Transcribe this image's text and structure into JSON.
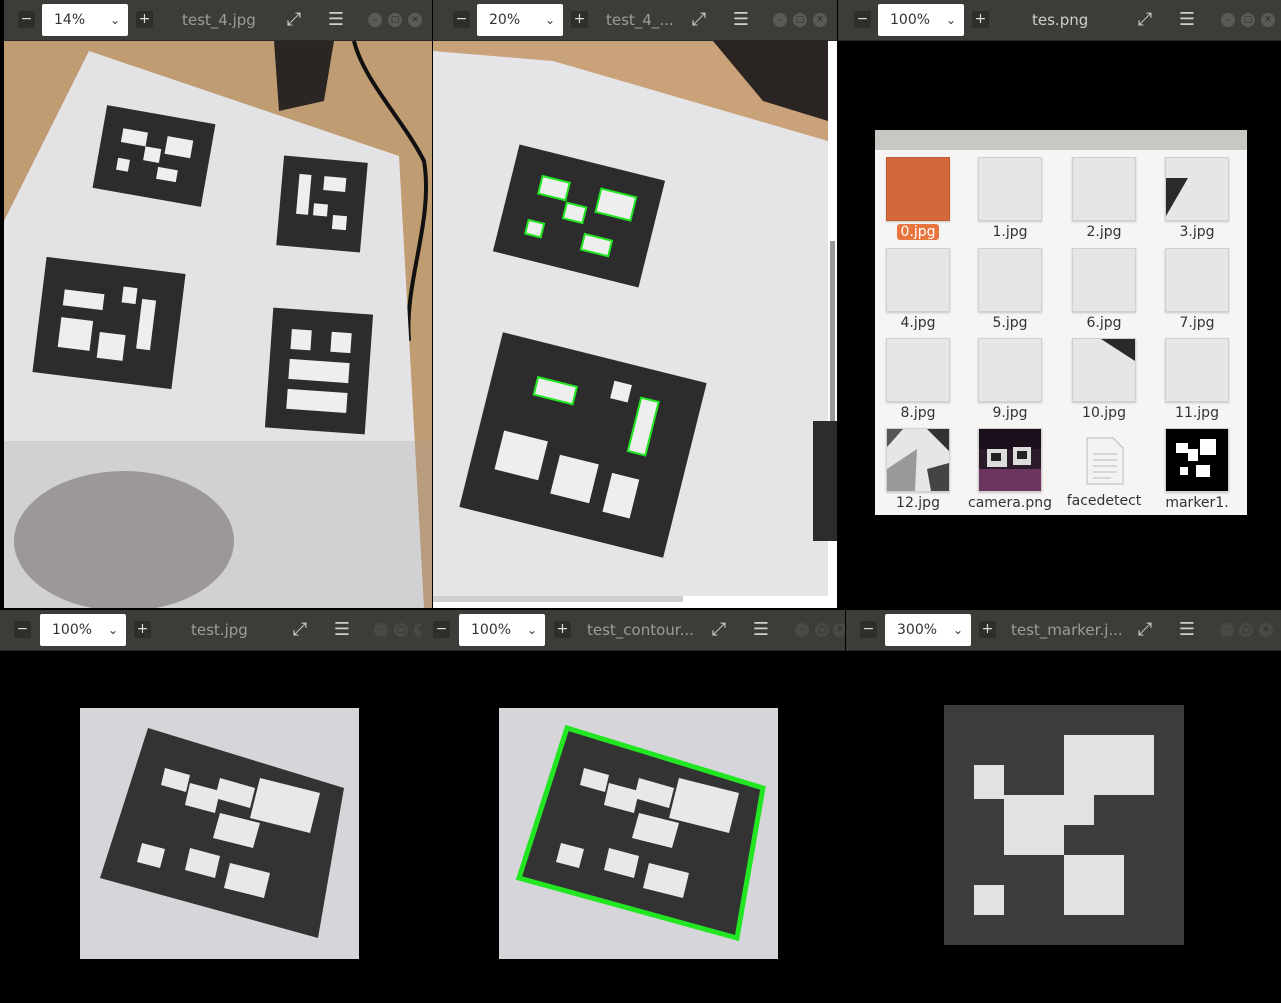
{
  "windows": [
    {
      "zoom": "14%",
      "title": "test_4.jpg"
    },
    {
      "zoom": "20%",
      "title": "test_4_..."
    },
    {
      "zoom": "100%",
      "title": "tes.png"
    },
    {
      "zoom": "100%",
      "title": "test.jpg"
    },
    {
      "zoom": "100%",
      "title": "test_contour..."
    },
    {
      "zoom": "300%",
      "title": "test_marker.j..."
    }
  ],
  "file_manager": {
    "files": [
      "0.jpg",
      "1.jpg",
      "2.jpg",
      "3.jpg",
      "4.jpg",
      "5.jpg",
      "6.jpg",
      "7.jpg",
      "8.jpg",
      "9.jpg",
      "10.jpg",
      "11.jpg",
      "12.jpg",
      "camera.png",
      "facedetect",
      "marker1."
    ],
    "selected": "0.jpg"
  },
  "colors": {
    "headerbar": "#3d3c38",
    "contour": "#22e622",
    "selection": "#e9753e"
  }
}
